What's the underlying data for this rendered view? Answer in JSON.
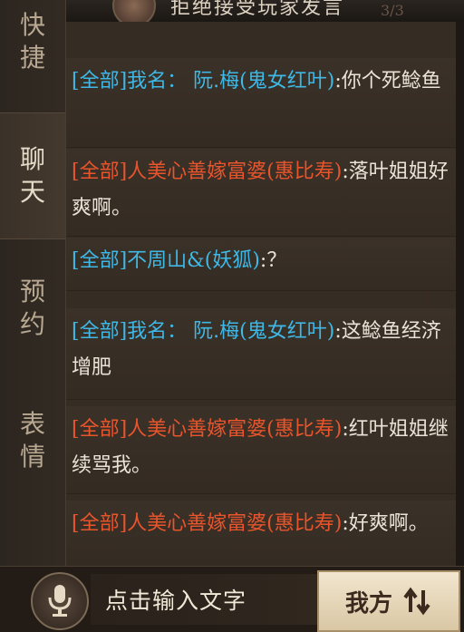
{
  "header": {
    "title": "拒绝接受玩家发言",
    "counter": "3/3"
  },
  "tabs": [
    {
      "chars": [
        "快",
        "捷"
      ],
      "active": false
    },
    {
      "chars": [
        "聊",
        "天"
      ],
      "active": true
    },
    {
      "chars": [
        "预",
        "约"
      ],
      "active": false
    },
    {
      "chars": [
        "表",
        "情"
      ],
      "active": false
    }
  ],
  "messages": [
    {
      "channel": "[全部]",
      "name": "我名： 阮.梅(鬼女红叶)",
      "text": ":你个死鲶鱼",
      "color": "blue"
    },
    {
      "channel": "[全部]",
      "name": "人美心善嫁富婆(惠比寿)",
      "text": ":落叶姐姐好爽啊。",
      "color": "red"
    },
    {
      "channel": "[全部]",
      "name": "不周山&(妖狐)",
      "text": ":？",
      "color": "blue"
    },
    {
      "channel": "[全部]",
      "name": "我名： 阮.梅(鬼女红叶)",
      "text": ":这鲶鱼经济增肥",
      "color": "blue"
    },
    {
      "channel": "[全部]",
      "name": "人美心善嫁富婆(惠比寿)",
      "text": ":红叶姐姐继续骂我。",
      "color": "red"
    },
    {
      "channel": "[全部]",
      "name": "人美心善嫁富婆(惠比寿)",
      "text": ":好爽啊。",
      "color": "red"
    }
  ],
  "input": {
    "placeholder": "点击输入文字"
  },
  "scope_button": {
    "label": "我方"
  },
  "colors": {
    "channel_blue": "#3fb8e6",
    "channel_red": "#e8552c",
    "message_text": "#eae3d6",
    "panel_bg": "#352c24"
  },
  "icons": {
    "voice": "mic-icon",
    "switch": "swap-arrows-icon"
  }
}
